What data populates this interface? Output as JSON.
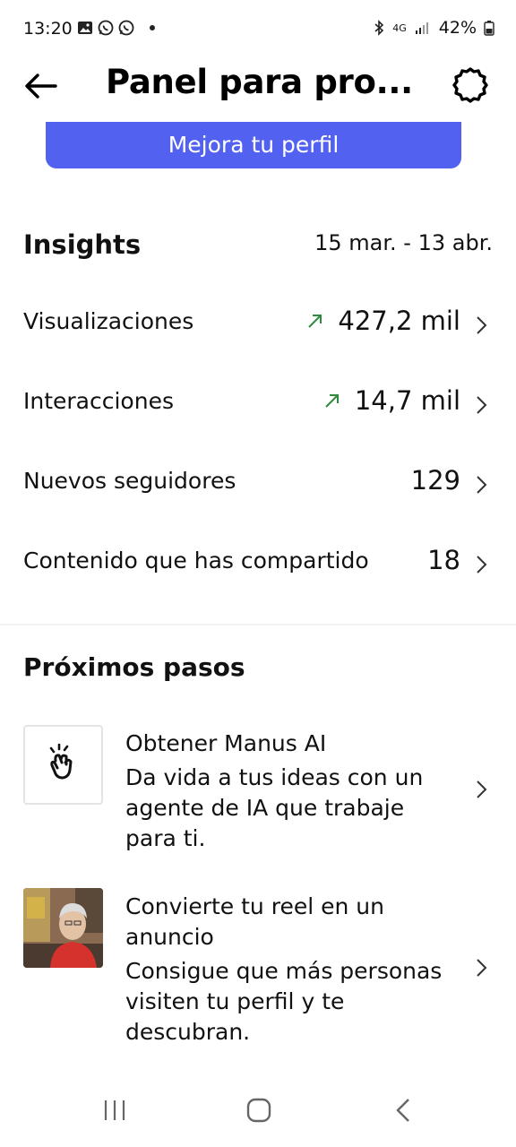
{
  "status_bar": {
    "time": "13:20",
    "network": "4G",
    "battery": "42%"
  },
  "header": {
    "title": "Panel para pro...",
    "back_icon": "arrow-left-icon",
    "settings_icon": "gear-icon"
  },
  "improve_button": {
    "label": "Mejora tu perfil",
    "color": "#5261f0"
  },
  "insights": {
    "title": "Insights",
    "date_range": "15 mar. - 13 abr.",
    "metrics": [
      {
        "label": "Visualizaciones",
        "value": "427,2 mil",
        "trend": "up"
      },
      {
        "label": "Interacciones",
        "value": "14,7 mil",
        "trend": "up"
      },
      {
        "label": "Nuevos seguidores",
        "value": "129",
        "trend": "none"
      },
      {
        "label": "Contenido que has compartido",
        "value": "18",
        "trend": "none"
      }
    ],
    "trend_color": "#2e8b3d"
  },
  "next_steps": {
    "title": "Próximos pasos",
    "items": [
      {
        "title": "Obtener Manus AI",
        "description": "Da vida a tus ideas con un agente de IA que trabaje para ti.",
        "thumb_icon": "manus-hand-icon"
      },
      {
        "title": "Convierte tu reel en un anuncio",
        "description": "Consigue que más personas visiten tu perfil y te descubran.",
        "thumb_icon": "reel-photo-thumbnail"
      }
    ]
  },
  "nav_bar": {
    "recent_icon": "recent-apps-icon",
    "home_icon": "home-icon",
    "back_icon": "nav-back-icon"
  }
}
